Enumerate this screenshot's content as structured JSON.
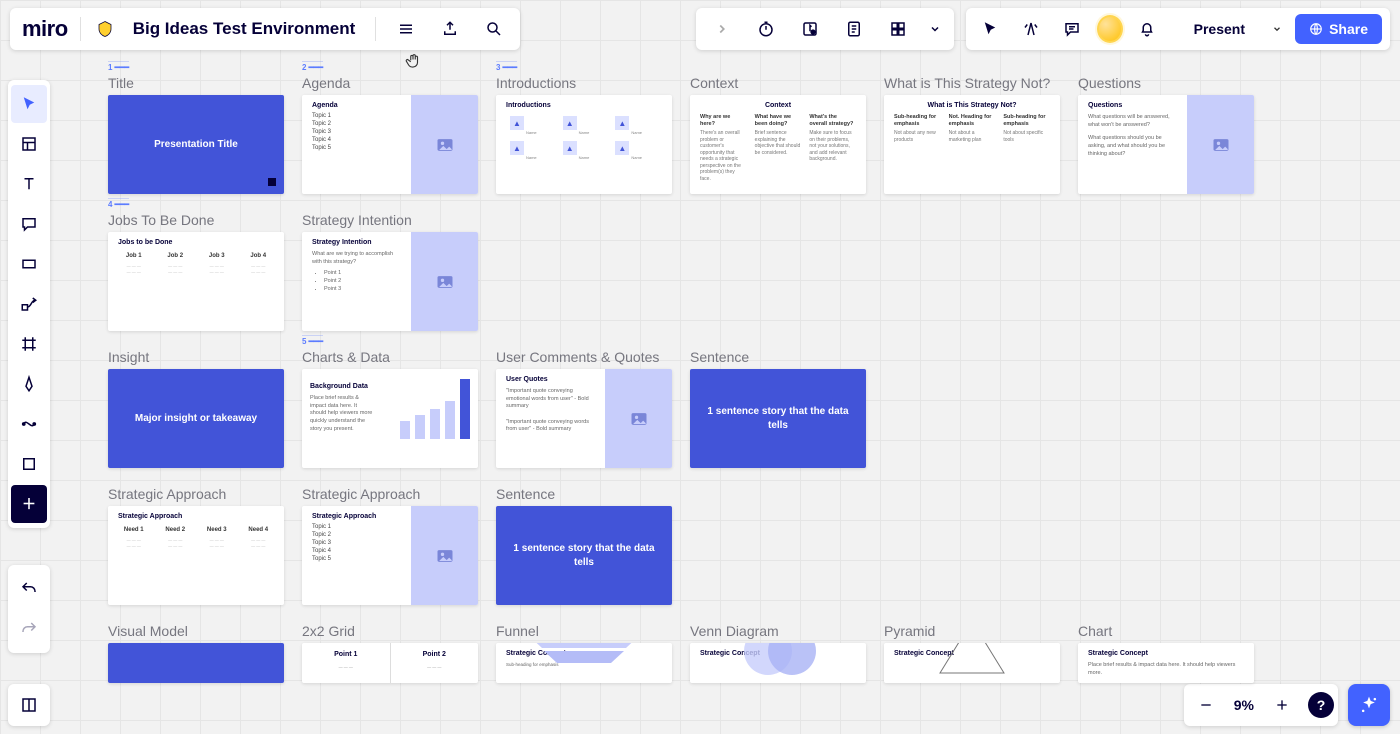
{
  "brand": "miro",
  "board_title": "Big Ideas Test Environment",
  "top_right": {
    "present": "Present",
    "share": "Share"
  },
  "zoom": {
    "level": "9%"
  },
  "colors": {
    "primary_blue": "#4262ff",
    "slide_blue": "#4254d8",
    "placeholder_lilac": "#c7cdfb"
  },
  "slides": {
    "row1": [
      {
        "idx": "1",
        "title": "Title",
        "type": "blue",
        "big": "Presentation Title"
      },
      {
        "idx": "2",
        "title": "Agenda",
        "hdr": "Agenda",
        "topics": [
          "Topic 1",
          "Topic 2",
          "Topic 3",
          "Topic 4",
          "Topic 5"
        ],
        "image": true
      },
      {
        "idx": "3",
        "title": "Introductions",
        "hdr": "Introductions",
        "avatars": 6
      },
      {
        "title": "Context",
        "hdr": "Context",
        "threecol": [
          {
            "q": "Why are we here?",
            "t": "There's an overall problem or customer's opportunity that needs a strategic perspective on the problem(s) they face."
          },
          {
            "q": "What have we been doing?",
            "t": "Brief sentence explaining the objective that should be considered."
          },
          {
            "q": "What's the overall strategy?",
            "t": "Make sure to focus on their problems, not your solutions, and add relevant background."
          }
        ]
      },
      {
        "title": "What is This Strategy Not?",
        "hdr": "What is This Strategy Not?",
        "threecol": [
          {
            "q": "Sub-heading for emphasis",
            "t": "Not about any new products"
          },
          {
            "q": "Not. Heading for emphasis",
            "t": "Not about a marketing plan"
          },
          {
            "q": "Sub-heading for emphasis",
            "t": "Not about specific tools"
          }
        ]
      },
      {
        "title": "Questions",
        "hdr": "Questions",
        "qtext": [
          "What questions will be answered, what won't be answered?",
          "What questions should you be asking, and what should you be thinking about?"
        ],
        "image": true
      }
    ],
    "row2": [
      {
        "idx": "4",
        "title": "Jobs To Be Done",
        "hdr": "Jobs to be Done",
        "jobs": [
          "Job 1",
          "Job 2",
          "Job 3",
          "Job 4"
        ]
      },
      {
        "title": "Strategy Intention",
        "hdr": "Strategy Intention",
        "intro": "What are we trying to accomplish with this strategy?",
        "points": [
          "Point 1",
          "Point 2",
          "Point 3"
        ],
        "image": true
      }
    ],
    "row3": [
      {
        "title": "Insight",
        "type": "blue",
        "big": "Major insight or takeaway"
      },
      {
        "idx": "5",
        "title": "Charts & Data",
        "hdr": "Background Data",
        "body": "Place brief results & impact data here. It should help viewers more quickly understand the story you present.",
        "bars": [
          18,
          24,
          30,
          38,
          60
        ]
      },
      {
        "title": "User Comments & Quotes",
        "hdr": "User Quotes",
        "quotes": true,
        "image": true
      },
      {
        "title": "Sentence",
        "type": "blue",
        "big": "1 sentence story that the data tells"
      }
    ],
    "row4": [
      {
        "title": "Strategic Approach",
        "hdr": "Strategic Approach",
        "jobs": [
          "Need 1",
          "Need 2",
          "Need 3",
          "Need 4"
        ]
      },
      {
        "title": "Strategic Approach",
        "hdr": "Strategic Approach",
        "topics": [
          "Topic 1",
          "Topic 2",
          "Topic 3",
          "Topic 4",
          "Topic 5"
        ],
        "image": true
      },
      {
        "title": "Sentence",
        "type": "blue",
        "big": "1 sentence story that the data tells"
      }
    ],
    "row5": [
      {
        "title": "Visual Model",
        "type": "blue",
        "big": ""
      },
      {
        "title": "2x2 Grid",
        "hdr2": [
          "Point 1",
          "Point 2"
        ]
      },
      {
        "title": "Funnel",
        "hdr": "Strategic Concept",
        "funnel": true
      },
      {
        "title": "Venn Diagram",
        "hdr": "Strategic Concept",
        "venn": true
      },
      {
        "title": "Pyramid",
        "hdr": "Strategic Concept",
        "pyramid": true
      },
      {
        "title": "Chart",
        "hdr": "Strategic Concept",
        "chartbody": "Place brief results & impact data here. It should help viewers more."
      }
    ]
  }
}
